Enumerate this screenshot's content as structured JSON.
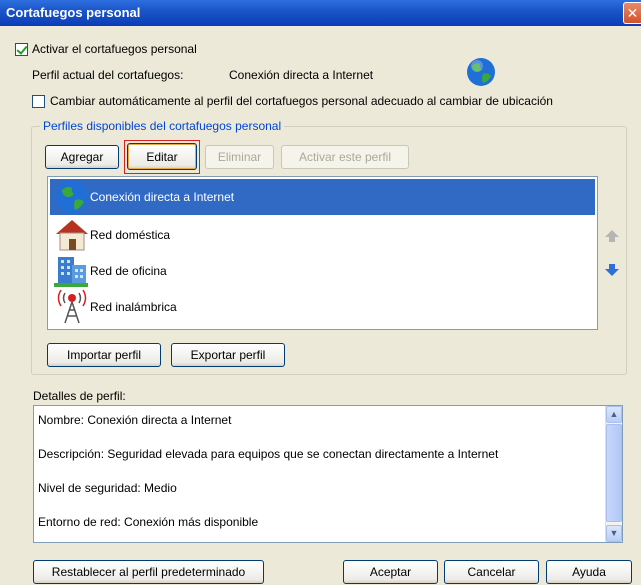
{
  "window": {
    "title": "Cortafuegos personal"
  },
  "enable_firewall": {
    "label": "Activar el cortafuegos personal",
    "checked": true
  },
  "current_profile": {
    "label": "Perfil actual del cortafuegos:",
    "value": "Conexión directa a Internet"
  },
  "auto_switch": {
    "label": "Cambiar automáticamente al perfil del cortafuegos personal adecuado al cambiar de ubicación",
    "checked": false
  },
  "profiles_group": {
    "legend": "Perfiles disponibles del cortafuegos personal",
    "buttons": {
      "add": "Agregar",
      "edit": "Editar",
      "remove": "Eliminar",
      "activate": "Activar este perfil"
    },
    "items": [
      {
        "label": "Conexión directa a Internet",
        "icon": "globe-icon",
        "selected": true
      },
      {
        "label": "Red doméstica",
        "icon": "house-icon",
        "selected": false
      },
      {
        "label": "Red de oficina",
        "icon": "office-building-icon",
        "selected": false
      },
      {
        "label": "Red inalámbrica",
        "icon": "wireless-tower-icon",
        "selected": false
      }
    ],
    "import_label": "Importar perfil",
    "export_label": "Exportar perfil"
  },
  "details": {
    "label": "Detalles de perfil:",
    "lines": [
      "Nombre: Conexión directa a Internet",
      "Descripción: Seguridad elevada para equipos que se conectan directamente a Internet",
      "Nivel de seguridad: Medio",
      "Entorno de red: Conexión más disponible"
    ]
  },
  "footer": {
    "reset": "Restablecer al perfil predeterminado",
    "ok": "Aceptar",
    "cancel": "Cancelar",
    "help": "Ayuda"
  },
  "colors": {
    "accent": "#316ac5",
    "legend": "#0046d5",
    "highlight": "#d72020"
  }
}
